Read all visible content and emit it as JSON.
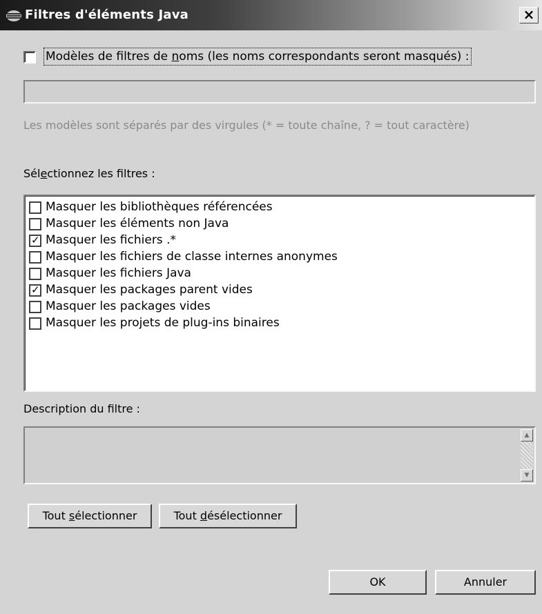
{
  "window": {
    "title": "Filtres d'éléments Java",
    "close_glyph": "×",
    "icon": "eclipse-icon"
  },
  "name_patterns": {
    "checkbox_checked": false,
    "label_pre": "Modèles de filtres de ",
    "label_u": "n",
    "label_post": "oms (les noms correspondants seront masqués) :",
    "input_value": "",
    "hint": "Les modèles sont séparés par des virgules (* = toute chaîne, ? = tout caractère)"
  },
  "filters": {
    "label_pre": "Sél",
    "label_u": "e",
    "label_post": "ctionnez les filtres :",
    "items": [
      {
        "label": "Masquer les bibliothèques référencées",
        "checked": false
      },
      {
        "label": "Masquer les éléments non Java",
        "checked": false
      },
      {
        "label": "Masquer les fichiers .*",
        "checked": true
      },
      {
        "label": "Masquer les fichiers de classe internes anonymes",
        "checked": false
      },
      {
        "label": "Masquer les fichiers Java",
        "checked": false
      },
      {
        "label": "Masquer les packages parent vides",
        "checked": true
      },
      {
        "label": "Masquer les packages vides",
        "checked": false
      },
      {
        "label": "Masquer les projets de plug-ins binaires",
        "checked": false
      }
    ]
  },
  "description": {
    "label": "Description du filtre :",
    "value": ""
  },
  "buttons": {
    "select_all": {
      "pre": "Tout ",
      "u": "s",
      "post": "électionner"
    },
    "deselect_all": {
      "pre": "Tout ",
      "u": "d",
      "post": "ésélectionner"
    },
    "ok": "OK",
    "cancel": "Annuler"
  }
}
